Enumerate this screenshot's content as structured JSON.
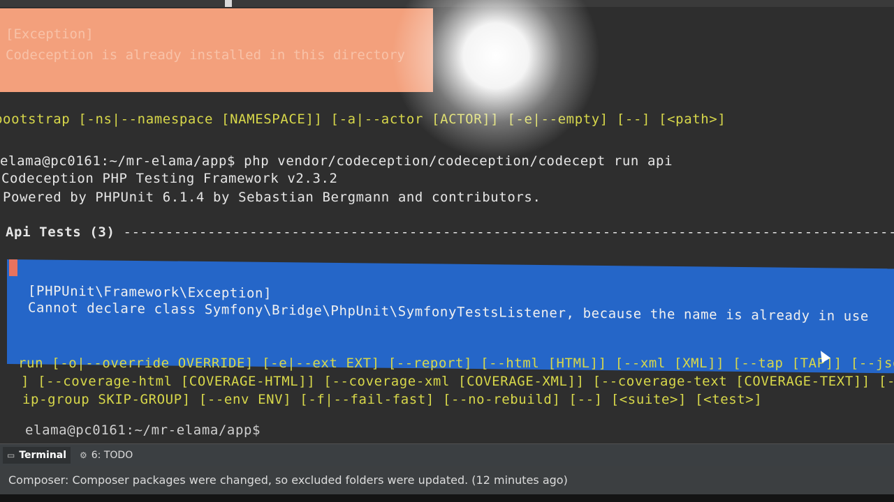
{
  "terminal": {
    "top_error": {
      "line1": "[Exception]",
      "line2": "Codeception is already installed in this directory"
    },
    "bootstrap_usage": "bootstrap [-ns|--namespace [NAMESPACE]] [-a|--actor [ACTOR]] [-e|--empty] [--] [<path>]",
    "command_line": "elama@pc0161:~/mr-elama/app$ php vendor/codeception/codeception/codecept run api",
    "version_line": "Codeception PHP Testing Framework v2.3.2",
    "powered_line": "Powered by PHPUnit 6.1.4 by Sebastian Bergmann and contributors.",
    "suite_header": "Api Tests (3)",
    "suite_header_rule": " -----------------------------------------------------------------------------------------------------------",
    "error_block": {
      "title": "[PHPUnit\\Framework\\Exception]",
      "message": "Cannot declare class Symfony\\Bridge\\PhpUnit\\SymfonyTestsListener, because the name is already in use"
    },
    "run_usage": [
      "run [-o|--override OVERRIDE] [-e|--ext EXT] [--report] [--html [HTML]] [--xml [XML]] [--tap [TAP]] [--json [JSON]]",
      "] [--coverage-html [COVERAGE-HTML]] [--coverage-xml [COVERAGE-XML]] [--coverage-text [COVERAGE-TEXT]] [--coverage-c",
      "ip-group SKIP-GROUP] [--env ENV] [-f|--fail-fast] [--no-rebuild] [--] [<suite>] [<test>]"
    ],
    "prompt": "elama@pc0161:~/mr-elama/app$"
  },
  "toolbar": {
    "terminal_tab": "Terminal",
    "todo_tab": "6: TODO"
  },
  "statusbar": {
    "message": "Composer: Composer packages were changed, so excluded folders were updated. (12 minutes ago)"
  },
  "colors": {
    "terminal_bg": "#2e2e2e",
    "usage_yellow": "#d8d84a",
    "error_blue": "#2566c8",
    "error_salmon": "#f3a07c"
  }
}
